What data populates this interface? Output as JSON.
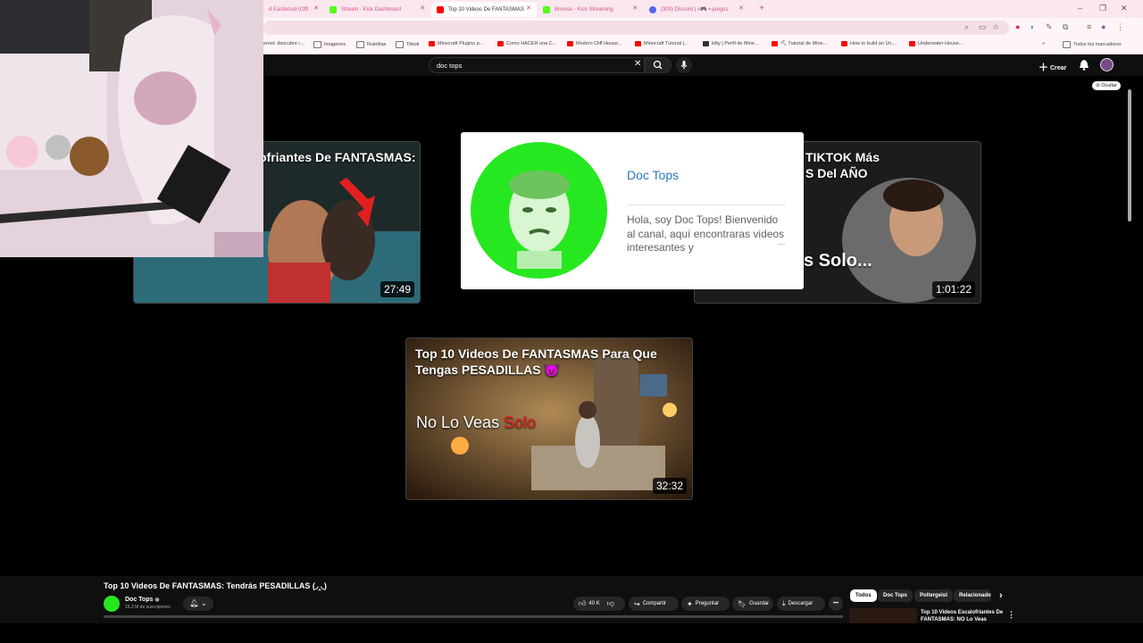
{
  "browser": {
    "tabs": [
      {
        "label": "d Eastwood (Offi",
        "favicon_color": "#ffffff"
      },
      {
        "label": "Stream - Kick Dashboard",
        "favicon_color": "#53fc18"
      },
      {
        "label": "Top 10 Videos De FANTASMAS",
        "favicon_color": "#ff0000"
      },
      {
        "label": "Browse - Kick Streaming",
        "favicon_color": "#53fc18"
      },
      {
        "label": "(303) Discord | #🎮-•-juegos",
        "favicon_color": "#5865f2"
      }
    ],
    "new_tab": "+",
    "bookmarks": [
      {
        "label": "erest: descubre i...",
        "color": "#e60023"
      },
      {
        "label": "Imagenes",
        "color": "#888888"
      },
      {
        "label": "Ruletitas",
        "color": "#888888"
      },
      {
        "label": "Tiktok",
        "color": "#888888"
      },
      {
        "label": "Minecraft Plugins p...",
        "color": "#ff0000"
      },
      {
        "label": "Como HACER una C...",
        "color": "#ff0000"
      },
      {
        "label": "Modern Cliff House...",
        "color": "#ff0000"
      },
      {
        "label": "Minecraft Tutorial |...",
        "color": "#ff0000"
      },
      {
        "label": "kitty | Perfil de Mine...",
        "color": "#333333"
      },
      {
        "label": "⛏ Tutorial de Mine...",
        "color": "#ff0000"
      },
      {
        "label": "How to build an Un...",
        "color": "#ff0000"
      },
      {
        "label": "Underwater House...",
        "color": "#ff0000"
      }
    ],
    "bookmarks_more": "»",
    "all_bookmarks": "Todos los marcadores"
  },
  "youtube": {
    "search_value": "doc tops",
    "create_label": "Crear",
    "hide_label": "Ocultar",
    "videos": [
      {
        "title": "ofriantes De FANTASMAS:",
        "duration": "27:49"
      },
      {
        "title": "TIKTOK Más\nS Del AÑO",
        "duration": "1:01:22",
        "overlay": "s Solo..."
      },
      {
        "title": "Top 10 Videos De FANTASMAS Para Que Tengas PESADILLAS 😈",
        "duration": "32:32",
        "overlay_a": "No Lo Veas ",
        "overlay_b": "Solo"
      }
    ],
    "channel_card": {
      "name": "Doc Tops",
      "description": "Hola, soy Doc Tops! Bienvenido al canal, aquí encontraras videos interesantes y",
      "more": "..."
    },
    "player": {
      "title": "Top 10 Videos De FANTASMAS: Tendrás PESADILLAS (◞‸◟)",
      "channel": "Doc Tops",
      "subscribers": "16,3 M de suscriptores",
      "likes": "40 K",
      "share": "Compartir",
      "ask": "Preguntar",
      "save": "Guardar",
      "download": "Descargar",
      "more": "•••"
    },
    "chips": [
      "Todos",
      "Doc Tops",
      "Poltergeist",
      "Relacionado"
    ],
    "next_chip": "›",
    "recommendation": {
      "title": "Top 10 Videos Escalofriantes De FANTASMAS: NO Lo Veas"
    }
  }
}
